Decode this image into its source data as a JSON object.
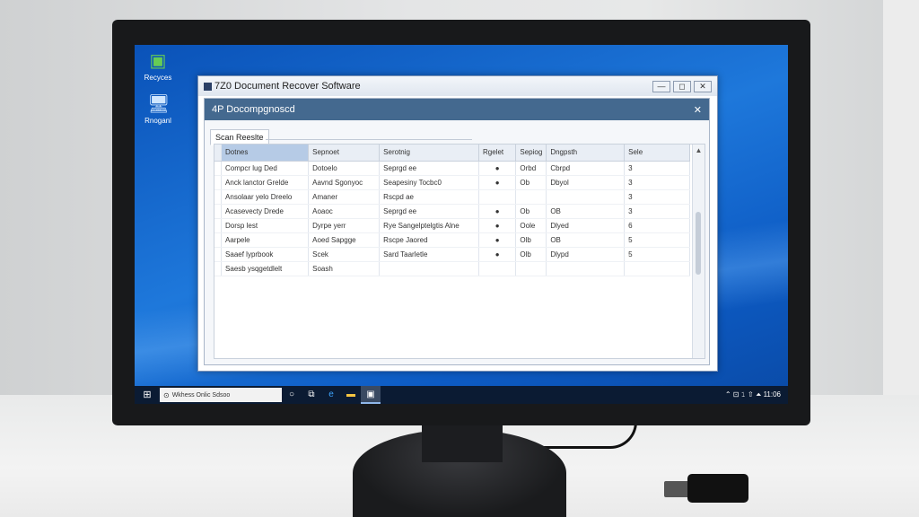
{
  "window": {
    "title": "7Z0 Document Recover Software",
    "min_label": "—",
    "max_label": "◻",
    "close_label": "✕"
  },
  "dialog": {
    "title": "4P Docompgnoscd",
    "close_label": "✕",
    "tab_label": "Scan Reeslte"
  },
  "table": {
    "columns": [
      "Dotnes",
      "Sepnoet",
      "Serotnig",
      "Rgelet",
      "Sepiog",
      "Dngpsth",
      "Sele"
    ],
    "rows": [
      [
        "Compcr lug Ded",
        "Dotoelo",
        "Seprgd ee",
        "●",
        "Orbd",
        "Cbrpd",
        "3"
      ],
      [
        "Anck lanctor Grelde",
        "Aavnd Sgonyoc",
        "Seapesiny Tocbc0",
        "●",
        "Ob",
        "Dbyol",
        "3"
      ],
      [
        "Ansolaar yelo Dreelo",
        "Amaner",
        "Rscpd ae",
        "",
        "",
        "",
        "3"
      ],
      [
        "Acasevecty Drede",
        "Aoaoc",
        "Seprgd ee",
        "●",
        "Ob",
        "OB",
        "3"
      ],
      [
        "Dorsp lest",
        "Dyrpe yerr",
        "Rye Sangelptelgtis Alne",
        "●",
        "Oole",
        "Dlyed",
        "6"
      ],
      [
        "Aarpele",
        "Aoed Sapgge",
        "Rscpe Jaored",
        "●",
        "Olb",
        "OB",
        "5"
      ],
      [
        "Saaef lyprbook",
        "Scek",
        "Sard Taarletle",
        "●",
        "Olb",
        "Dlypd",
        "5"
      ],
      [
        "Saesb ysqgetdlelt",
        "Soash",
        "",
        "",
        "",
        "",
        ""
      ]
    ]
  },
  "desktop": {
    "icons": [
      {
        "label": "Recyces",
        "icon": "recycle-bin-icon"
      },
      {
        "label": "Rnoganl",
        "icon": "computer-icon"
      }
    ]
  },
  "taskbar": {
    "search_text": "Wkhess Onlic Sdsoo",
    "tray_text": "⌃ ⊡ 𝟷 ⇧ ⏶ 11:06"
  }
}
